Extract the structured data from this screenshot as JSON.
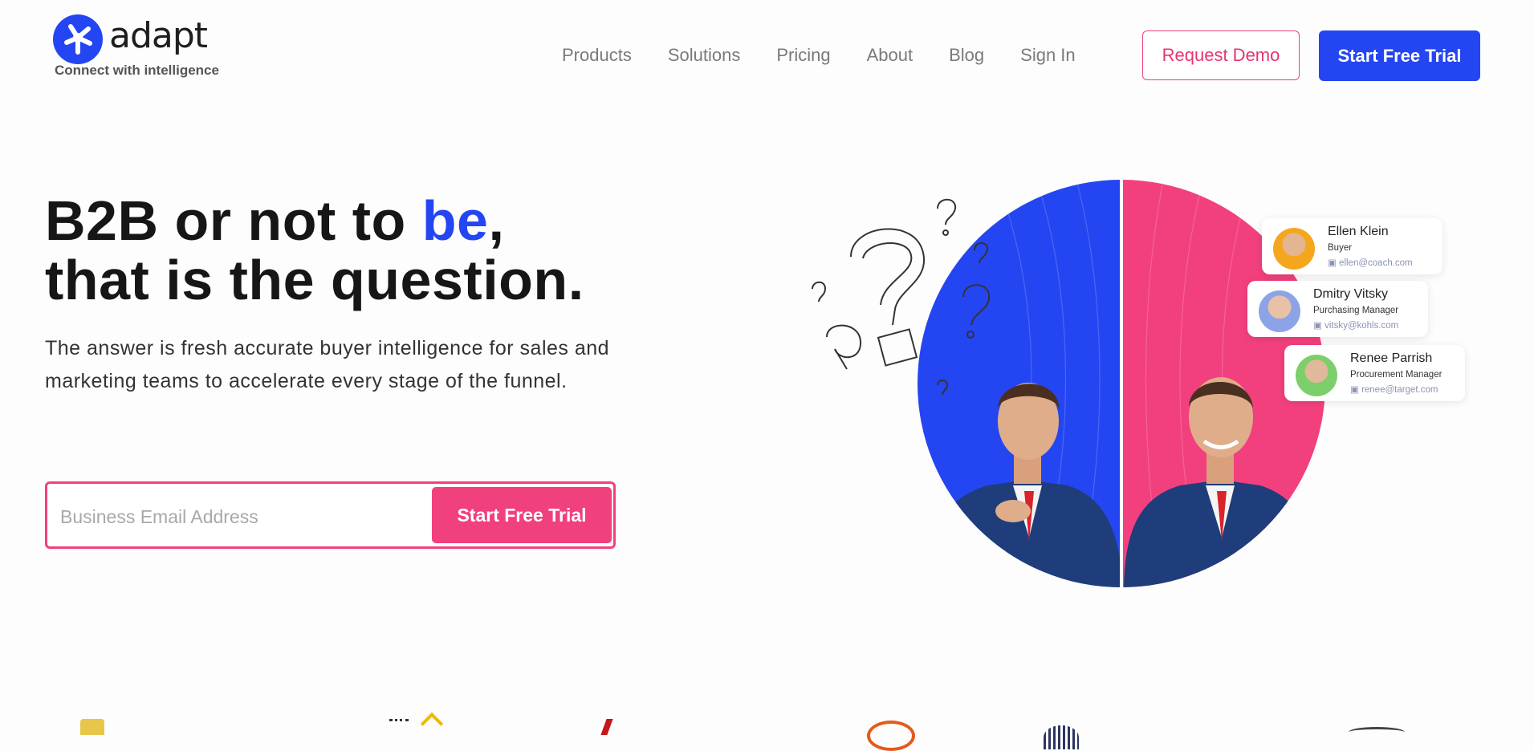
{
  "brand": {
    "name": "adapt",
    "tagline": "Connect with intelligence",
    "color": "#2446f2"
  },
  "nav": {
    "items": [
      "Products",
      "Solutions",
      "Pricing",
      "About",
      "Blog",
      "Sign In"
    ],
    "request_demo": "Request Demo",
    "start_trial": "Start Free Trial"
  },
  "hero": {
    "headline_part1": "B2B or not to ",
    "headline_accent": "be",
    "headline_part2": ",",
    "headline_line2": "that is the question.",
    "subtext": "The answer is fresh accurate buyer intelligence for sales and marketing teams to accelerate every stage of the funnel.",
    "email_placeholder": "Business Email Address",
    "email_value": "",
    "cta": "Start Free Trial"
  },
  "contacts": [
    {
      "name": "Ellen Klein",
      "role": "Buyer",
      "email": "ellen@coach.com"
    },
    {
      "name": "Dmitry Vitsky",
      "role": "Purchasing Manager",
      "email": "vitsky@kohls.com"
    },
    {
      "name": "Renee Parrish",
      "role": "Procurement Manager",
      "email": "renee@target.com"
    }
  ],
  "colors": {
    "accent_blue": "#2446f2",
    "accent_pink": "#f2407e"
  }
}
